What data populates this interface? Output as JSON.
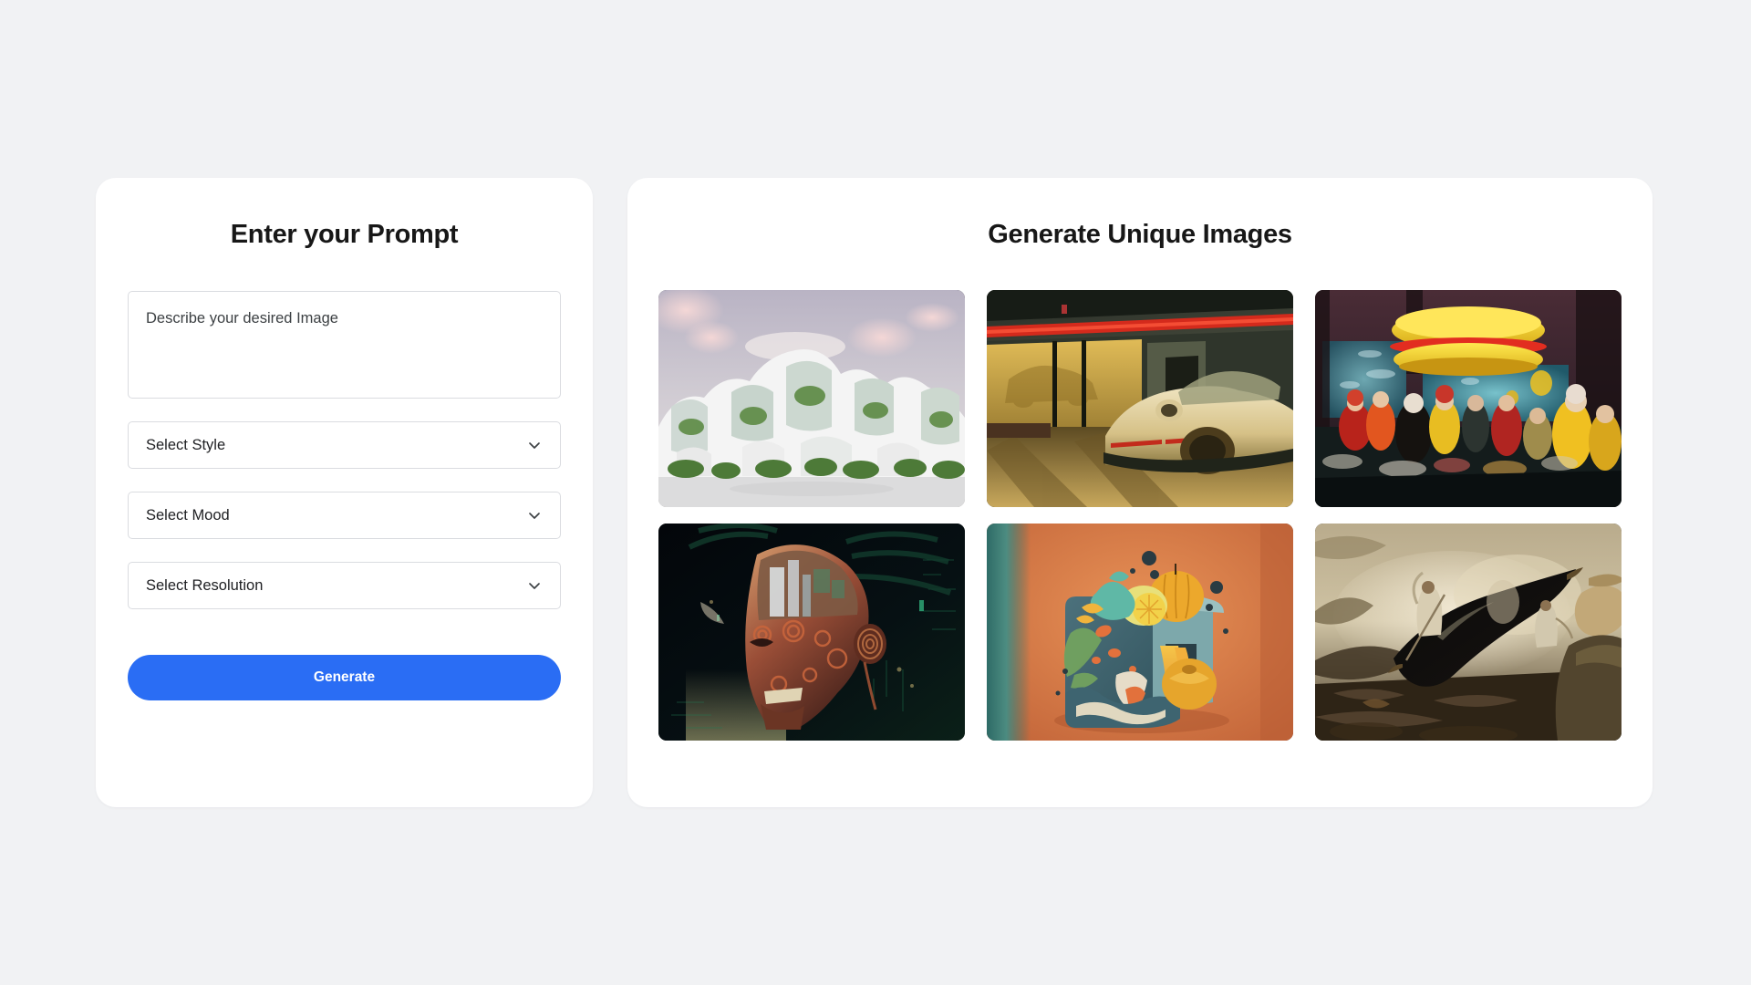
{
  "page": {
    "background_color": "#f1f2f4"
  },
  "prompt_panel": {
    "title": "Enter your Prompt",
    "textarea": {
      "placeholder": "Describe your desired Image",
      "value": ""
    },
    "selects": [
      {
        "label": "Select Style",
        "icon": "chevron-down-icon"
      },
      {
        "label": "Select Mood",
        "icon": "chevron-down-icon"
      },
      {
        "label": "Select Resolution",
        "icon": "chevron-down-icon"
      }
    ],
    "generate_button": {
      "label": "Generate",
      "color": "#2a6df4",
      "text_color": "#ffffff"
    }
  },
  "gallery_panel": {
    "title": "Generate Unique Images",
    "images": [
      {
        "name": "organic-white-architecture",
        "description": "Futuristic organic white architecture with curved biomorphic shells, glass windows, lush green plants and pink blossom trees under a pastel sky",
        "palette": [
          "#c9b6bd",
          "#f2e3e4",
          "#ffffff",
          "#6f8f4e",
          "#d8dde2"
        ]
      },
      {
        "name": "golden-sports-car-showroom",
        "description": "Cream-gold vintage sports car parked outside a showroom with a glowing red neon strip and long evening shadows",
        "palette": [
          "#1d2420",
          "#e03024",
          "#d8b765",
          "#8a7a3c",
          "#2b2e26"
        ]
      },
      {
        "name": "underwater-burger-crowd",
        "description": "Surreal underwater scene with a giant yellow hamburger floating above a dense crowd in red and yellow rain gear amid debris",
        "palette": [
          "#3d2730",
          "#f2d01e",
          "#e03b22",
          "#2f7f96",
          "#0d1418"
        ]
      },
      {
        "name": "biomechanical-cyborg-head",
        "description": "Intricate biomechanical cyborg head assembled from gears and circuitry, set against a dark glitching circuit board background",
        "palette": [
          "#05070a",
          "#8a4b39",
          "#c26a4a",
          "#2fae7c",
          "#e0d79a"
        ]
      },
      {
        "name": "teal-cube-fruit-render",
        "description": "3D render of a rounded teal cube overflowing with stylized fruit, melting orange juice and coral foliage on a warm orange backdrop",
        "palette": [
          "#d8783f",
          "#3c6b76",
          "#f2a93b",
          "#7fc9b6",
          "#e8d9a0"
        ]
      },
      {
        "name": "misty-swoosh-painting",
        "description": "Painterly misty landscape with a large black swoosh form, robed figures in fog and a cloaked figure in the foreground",
        "palette": [
          "#cdbfa2",
          "#7a6a50",
          "#0a0a0a",
          "#3a3024",
          "#e3d8c0"
        ]
      }
    ]
  }
}
